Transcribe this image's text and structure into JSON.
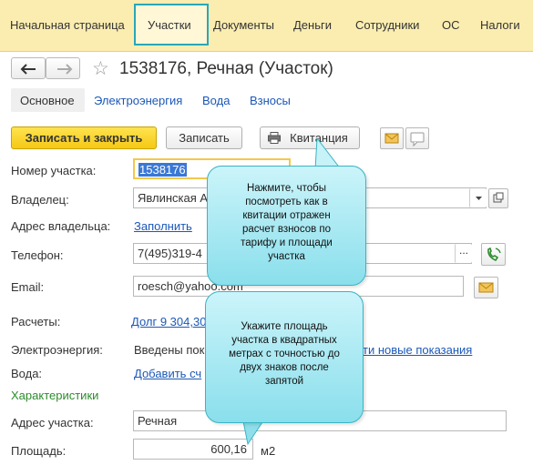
{
  "nav": {
    "tabs": [
      "Начальная страница",
      "Участки",
      "Документы",
      "Деньги",
      "Сотрудники",
      "ОС",
      "Налоги"
    ],
    "active_tab": "Участки"
  },
  "header": {
    "title": "1538176, Речная (Участок)",
    "back_icon": "arrow-left-icon",
    "forward_icon": "arrow-right-icon",
    "favorite_icon": "star-icon"
  },
  "subtabs": {
    "active": "Основное",
    "items": [
      "Электроэнергия",
      "Вода",
      "Взносы"
    ]
  },
  "actions": {
    "save_close": "Записать и закрыть",
    "save": "Записать",
    "receipt": "Квитанция"
  },
  "form": {
    "plot_number_label": "Номер участка:",
    "plot_number_value": "1538176",
    "owner_label": "Владелец:",
    "owner_value": "Явлинская А",
    "owner_address_label": "Адрес владельца:",
    "owner_address_link": "Заполнить",
    "phone_label": "Телефон:",
    "phone_value": "7(495)319-4",
    "email_label": "Email:",
    "email_value": "roesch@yahoo.com",
    "settlements_label": "Расчеты:",
    "settlements_link": "Долг 9 304,30",
    "electricity_label": "Электроэнергия:",
    "electricity_text": "Введены пок",
    "electricity_link": "ти новые показания",
    "water_label": "Вода:",
    "water_link": "Добавить сч",
    "characteristics_heading": "Характеристики",
    "plot_address_label": "Адрес участка:",
    "plot_address_value": "Речная",
    "area_label": "Площадь:",
    "area_value": "600,16",
    "area_unit": "м2"
  },
  "tooltips": {
    "receipt_hint": [
      "Нажмите, чтобы",
      "посмотреть как в",
      "квитации отражен",
      "расчет взносов по",
      "тарифу и площади",
      "участка"
    ],
    "area_hint": [
      "Укажите площадь",
      "участка в квадратных",
      "метрах с точностью до",
      "двух знаков после",
      "запятой"
    ]
  },
  "colors": {
    "topbar_bg": "#fbedb0",
    "active_tab_border": "#2aa6b8",
    "primary_button": "#f5c914",
    "link": "#1b58b8",
    "section_heading": "#2e8b2e",
    "tooltip_fill": "#a9e9f2"
  }
}
